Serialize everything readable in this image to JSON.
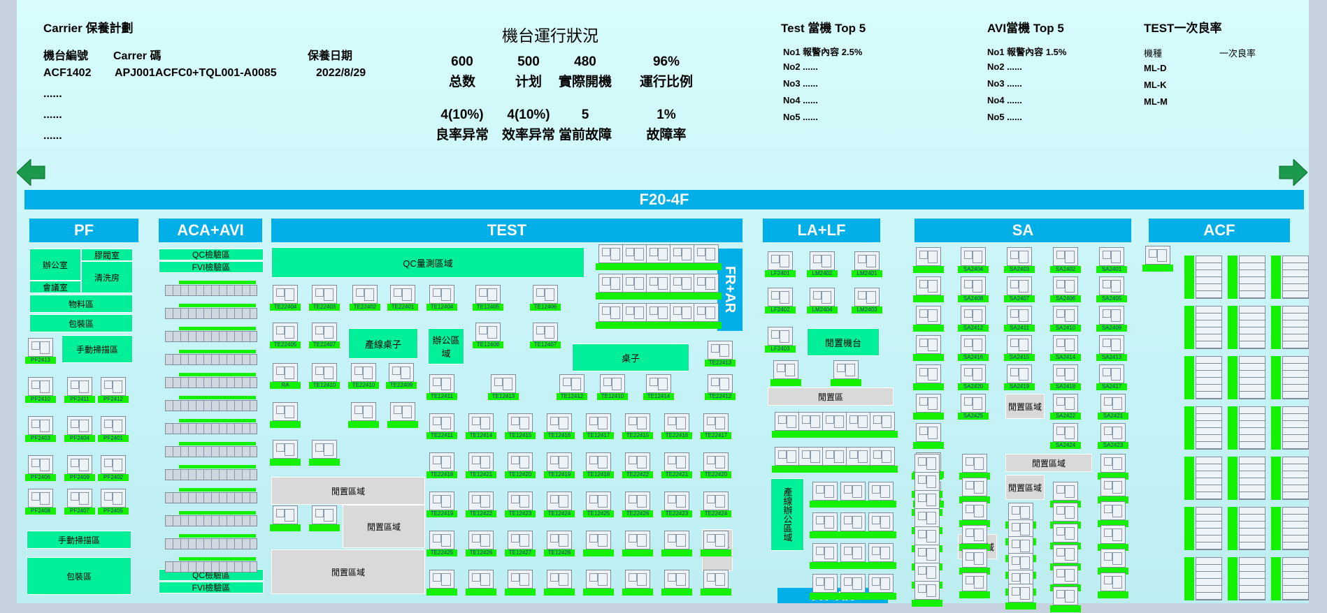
{
  "carrier": {
    "title": "Carrier 保養計劃",
    "col1": "機台編號",
    "col2": "Carrer 碼",
    "col3": "保養日期",
    "row_id": "ACF1402",
    "row_code": "APJ001ACFC0+TQL001-A0085",
    "row_date": "2022/8/29",
    "dots": "......"
  },
  "status": {
    "title": "機台運行狀況",
    "stats": [
      {
        "v": "600",
        "l": "总数"
      },
      {
        "v": "500",
        "l": "计划"
      },
      {
        "v": "480",
        "l": "實際開機"
      },
      {
        "v": "96%",
        "l": "運行比例"
      },
      {
        "v": "4(10%)",
        "l": "良率异常"
      },
      {
        "v": "4(10%)",
        "l": "效率异常"
      },
      {
        "v": "5",
        "l": "當前故障"
      },
      {
        "v": "1%",
        "l": "故障率"
      }
    ]
  },
  "test_top": {
    "title": "Test 當機 Top 5",
    "rows": [
      "No1  報警內容   2.5%",
      "No2  ......",
      "No3  ......",
      "No4  ......",
      "No5  ......"
    ]
  },
  "avi_top": {
    "title": "AVI當機 Top 5",
    "rows": [
      "No1  報警內容   1.5%",
      "No2  ......",
      "No3  ......",
      "No4  ......",
      "No5  ......"
    ]
  },
  "yield": {
    "title": "TEST一次良率",
    "h1": "機種",
    "h2": "一次良率",
    "rows": [
      "ML-D",
      "ML-K",
      "ML-M"
    ]
  },
  "floor": {
    "title": "F20-4F"
  },
  "areas": {
    "pf": "PF",
    "aca": "ACA+AVI",
    "test": "TEST",
    "lalf": "LA+LF",
    "sa": "SA",
    "acf": "ACF",
    "frar": "FR+AR",
    "frar2": "FR+AR"
  },
  "pf": {
    "office": "辦公室",
    "glue": "膠閥室",
    "clean": "清洗房",
    "meeting": "會議室",
    "material": "物料區",
    "pack": "包裝區",
    "manual": "手動掃描區",
    "manual2": "手動掃描區",
    "pack2": "包裝區"
  },
  "aca": {
    "qc": "QC檢驗區",
    "fvi": "FVI檢驗區",
    "qc2": "QC檢驗區",
    "fvi2": "FVI檢驗區"
  },
  "test": {
    "qc": "QC量測區域",
    "desk": "產線桌子",
    "office": "辦公區域",
    "table": "桌子",
    "idle1": "閒置區域",
    "idle2": "閒置區域",
    "idle3": "閒置區域",
    "idle4": "閒置區"
  },
  "lalf": {
    "idle_machine": "閒置機台",
    "idle": "閒置區",
    "office": "產線辦公區域"
  },
  "sa": {
    "idle1": "閒置區域",
    "idle2": "閒置區域",
    "idle3": "閒置區域",
    "idle4": "閒置區域"
  },
  "machines": {
    "pf": [
      "PF2413",
      "PF2410",
      "PF2411",
      "PF2412",
      "PF2403",
      "PF2404",
      "PF2401",
      "PF2406",
      "PF2409",
      "PF2402",
      "PF2408",
      "PF2407",
      "PF2405"
    ],
    "test": [
      "TE22404",
      "TE22403",
      "TE22402",
      "TE22401",
      "TE12404",
      "TE12405",
      "TE12406",
      "TE22405",
      "TE22407",
      "TE12408",
      "TE12407",
      "RA",
      "TE12410",
      "TE22410",
      "TE22409",
      "TE12411",
      "TE12413",
      "TE12412",
      "TE12410",
      "TE12414",
      "TE22413",
      "TE22412",
      "TE22411",
      "TE12414",
      "TE12415",
      "TE12416",
      "TE12417",
      "TE22415",
      "TE22416",
      "TE22417",
      "TE22418",
      "TE12421",
      "TE12420",
      "TE12419",
      "TE12418",
      "TE22422",
      "TE22421",
      "TE22420",
      "TE22419",
      "TE12422",
      "TE12423",
      "TE12424",
      "TE12425",
      "TE22426",
      "TE22423",
      "TE22424",
      "TE22425",
      "TE12426",
      "TE12427",
      "TE12428"
    ],
    "lalf": [
      "LF2401",
      "LM2402",
      "LM2401",
      "LF2402",
      "LM2404",
      "LM2403",
      "LF2403"
    ],
    "sa": [
      "SA2404",
      "SA2403",
      "SA2402",
      "SA2401",
      "SA2408",
      "SA2407",
      "SA2406",
      "SA2405",
      "SA2412",
      "SA2411",
      "SA2410",
      "SA2409",
      "SA2416",
      "SA2415",
      "SA2414",
      "SA2413",
      "SA2420",
      "SA2419",
      "SA2418",
      "SA2417",
      "SA2425",
      "SA2422",
      "SA2421",
      "SA2424",
      "SA2423"
    ]
  },
  "colors": {
    "header": "#00aee8",
    "zone": "#00f09a",
    "label": "#14f000",
    "idle": "#d9d9d9",
    "arrow": "#1a9a4a"
  }
}
